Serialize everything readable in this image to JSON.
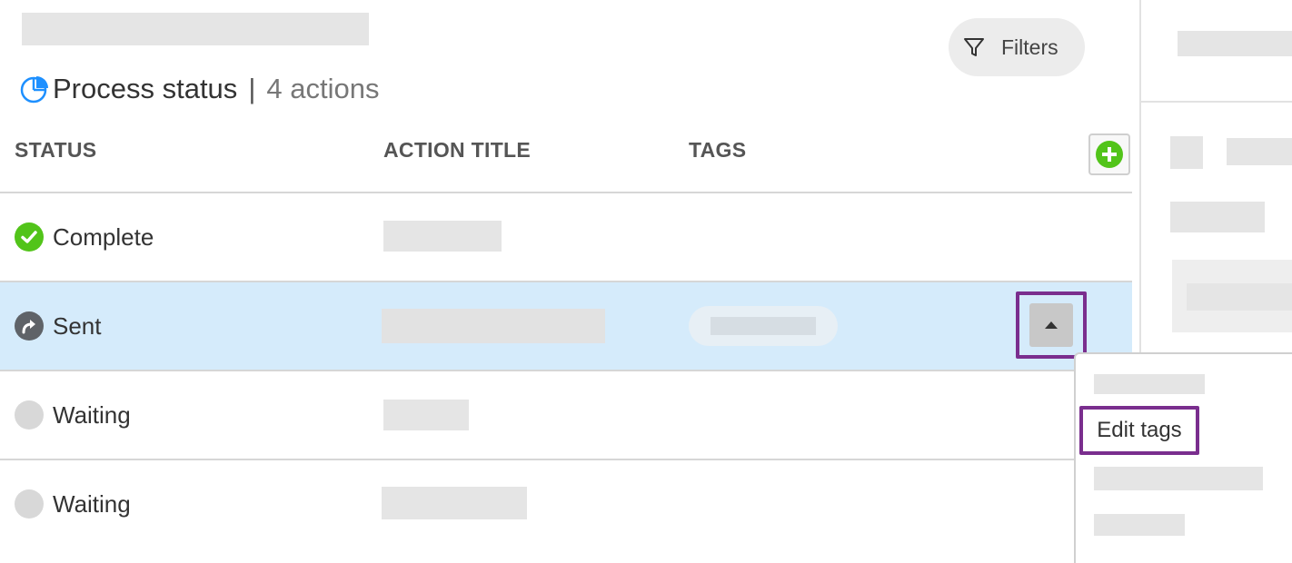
{
  "header": {
    "title": "Process status",
    "separator": "|",
    "actions_count": "4 actions",
    "filters_label": "Filters"
  },
  "table": {
    "columns": [
      "STATUS",
      "ACTION TITLE",
      "TAGS"
    ],
    "rows": [
      {
        "status": "Complete",
        "icon": "check-circle-icon"
      },
      {
        "status": "Sent",
        "icon": "share-arrow-icon",
        "selected": true
      },
      {
        "status": "Waiting",
        "icon": "empty-circle-icon"
      },
      {
        "status": "Waiting",
        "icon": "empty-circle-icon"
      }
    ]
  },
  "dropdown": {
    "edit_tags_label": "Edit tags"
  },
  "colors": {
    "accent_purple": "#7a2e8e",
    "complete_green": "#52c41a",
    "selected_row": "#d5ebfb",
    "pie_blue": "#1e90ff"
  }
}
